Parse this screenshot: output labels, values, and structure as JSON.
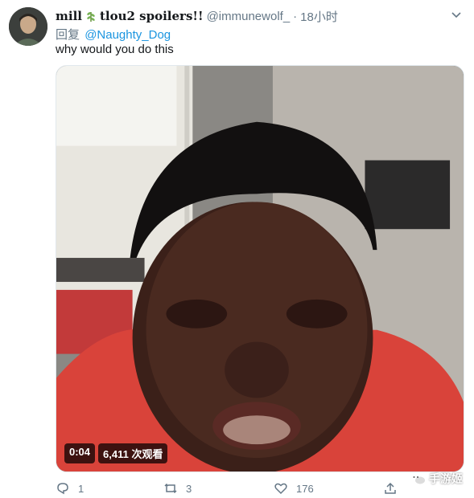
{
  "tweet": {
    "display_name": "mill",
    "display_name_suffix": "tlou2 spoilers!!",
    "handle": "@immunewolf_",
    "separator": "·",
    "time": "18小时",
    "reply_prefix": "回复",
    "reply_mention": "@Naughty_Dog",
    "text": "why would you do this"
  },
  "media": {
    "duration": "0:04",
    "views": "6,411 次观看"
  },
  "actions": {
    "reply_count": "1",
    "retweet_count": "3",
    "like_count": "176"
  },
  "watermark": {
    "text": "手游姬"
  },
  "colors": {
    "link": "#1b95e0",
    "muted": "#657786",
    "text": "#14171a"
  }
}
